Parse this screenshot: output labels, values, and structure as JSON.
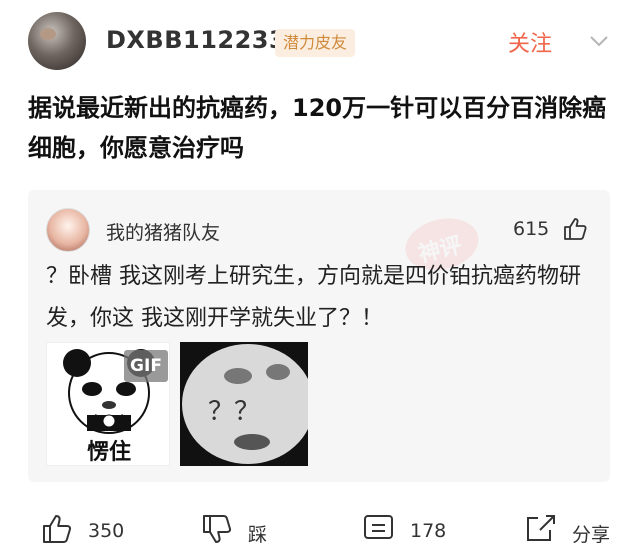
{
  "post": {
    "username": "DXBB112233",
    "badge": "潜力皮友",
    "follow_label": "关注",
    "title": "据说最近新出的抗癌药，120万一针可以百分百消除癌细胞，你愿意治疗吗"
  },
  "comment": {
    "username": "我的猪猪队友",
    "likes": "615",
    "text": "？卧槽 我这刚考上研究生，方向就是四价铂抗癌药物研发，你这 我这刚开学就失业了？！",
    "stamp": "神评",
    "gif_badge": "GIF",
    "meme1_caption": "愣住",
    "meme2_caption": "？？"
  },
  "footer": {
    "like_count": "350",
    "dislike_label": "踩",
    "comment_count": "178",
    "share_label": "分享"
  },
  "colors": {
    "accent": "#f0664a",
    "badge_bg": "#fbeee0",
    "badge_text": "#d08a3c",
    "card_bg": "#f6f6f6"
  }
}
